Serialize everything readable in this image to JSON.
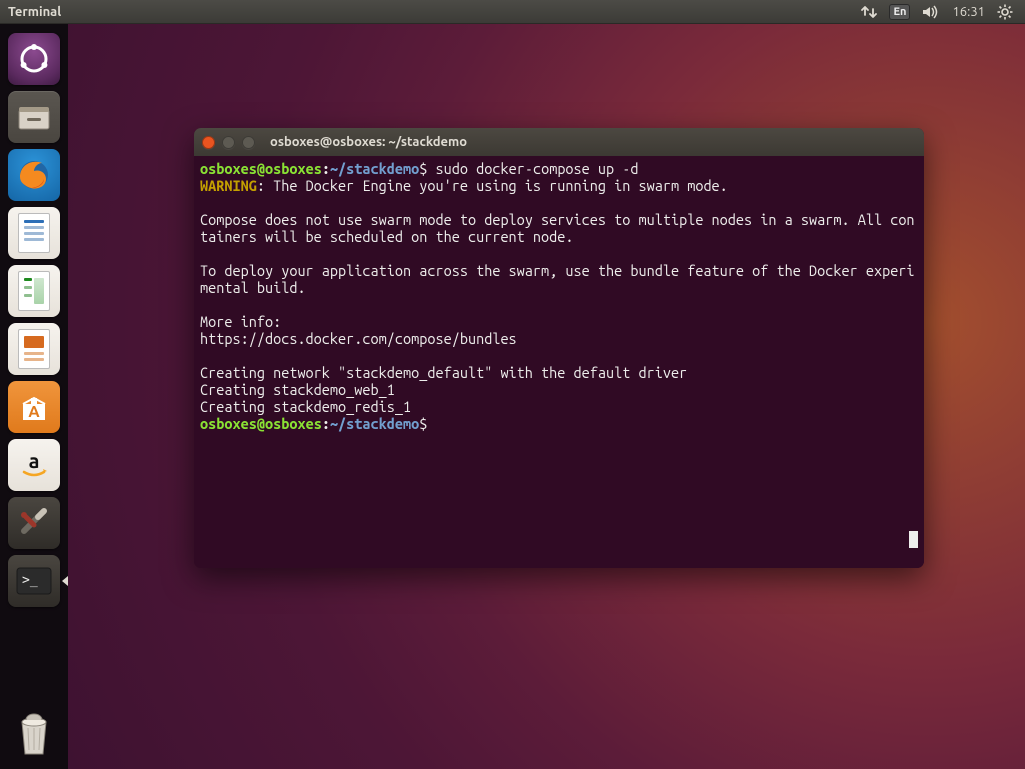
{
  "topbar": {
    "title": "Terminal",
    "input_method": "En",
    "clock": "16:31"
  },
  "launcher": {
    "items": [
      {
        "name": "ubuntu-dash"
      },
      {
        "name": "files"
      },
      {
        "name": "firefox"
      },
      {
        "name": "writer"
      },
      {
        "name": "calc"
      },
      {
        "name": "impress"
      },
      {
        "name": "software"
      },
      {
        "name": "amazon"
      },
      {
        "name": "settings"
      },
      {
        "name": "terminal"
      }
    ],
    "trash": "trash"
  },
  "terminal": {
    "title": "osboxes@osboxes: ~/stackdemo",
    "prompt": {
      "user": "osboxes",
      "at": "@",
      "host": "osboxes",
      "colon": ":",
      "path": "~/stackdemo",
      "dollar": "$"
    },
    "command": "sudo docker-compose up -d",
    "output": {
      "warn_label": "WARNING",
      "warn_rest": ": The Docker Engine you're using is running in swarm mode.",
      "blank1": "",
      "l1": "Compose does not use swarm mode to deploy services to multiple nodes in a swarm. All containers will be scheduled on the current node.",
      "blank2": "",
      "l2": "To deploy your application across the swarm, use the bundle feature of the Docker experimental build.",
      "blank3": "",
      "l3": "More info:",
      "l4": "https://docs.docker.com/compose/bundles",
      "blank4": "",
      "l5": "Creating network \"stackdemo_default\" with the default driver",
      "l6": "Creating stackdemo_web_1",
      "l7": "Creating stackdemo_redis_1"
    }
  }
}
